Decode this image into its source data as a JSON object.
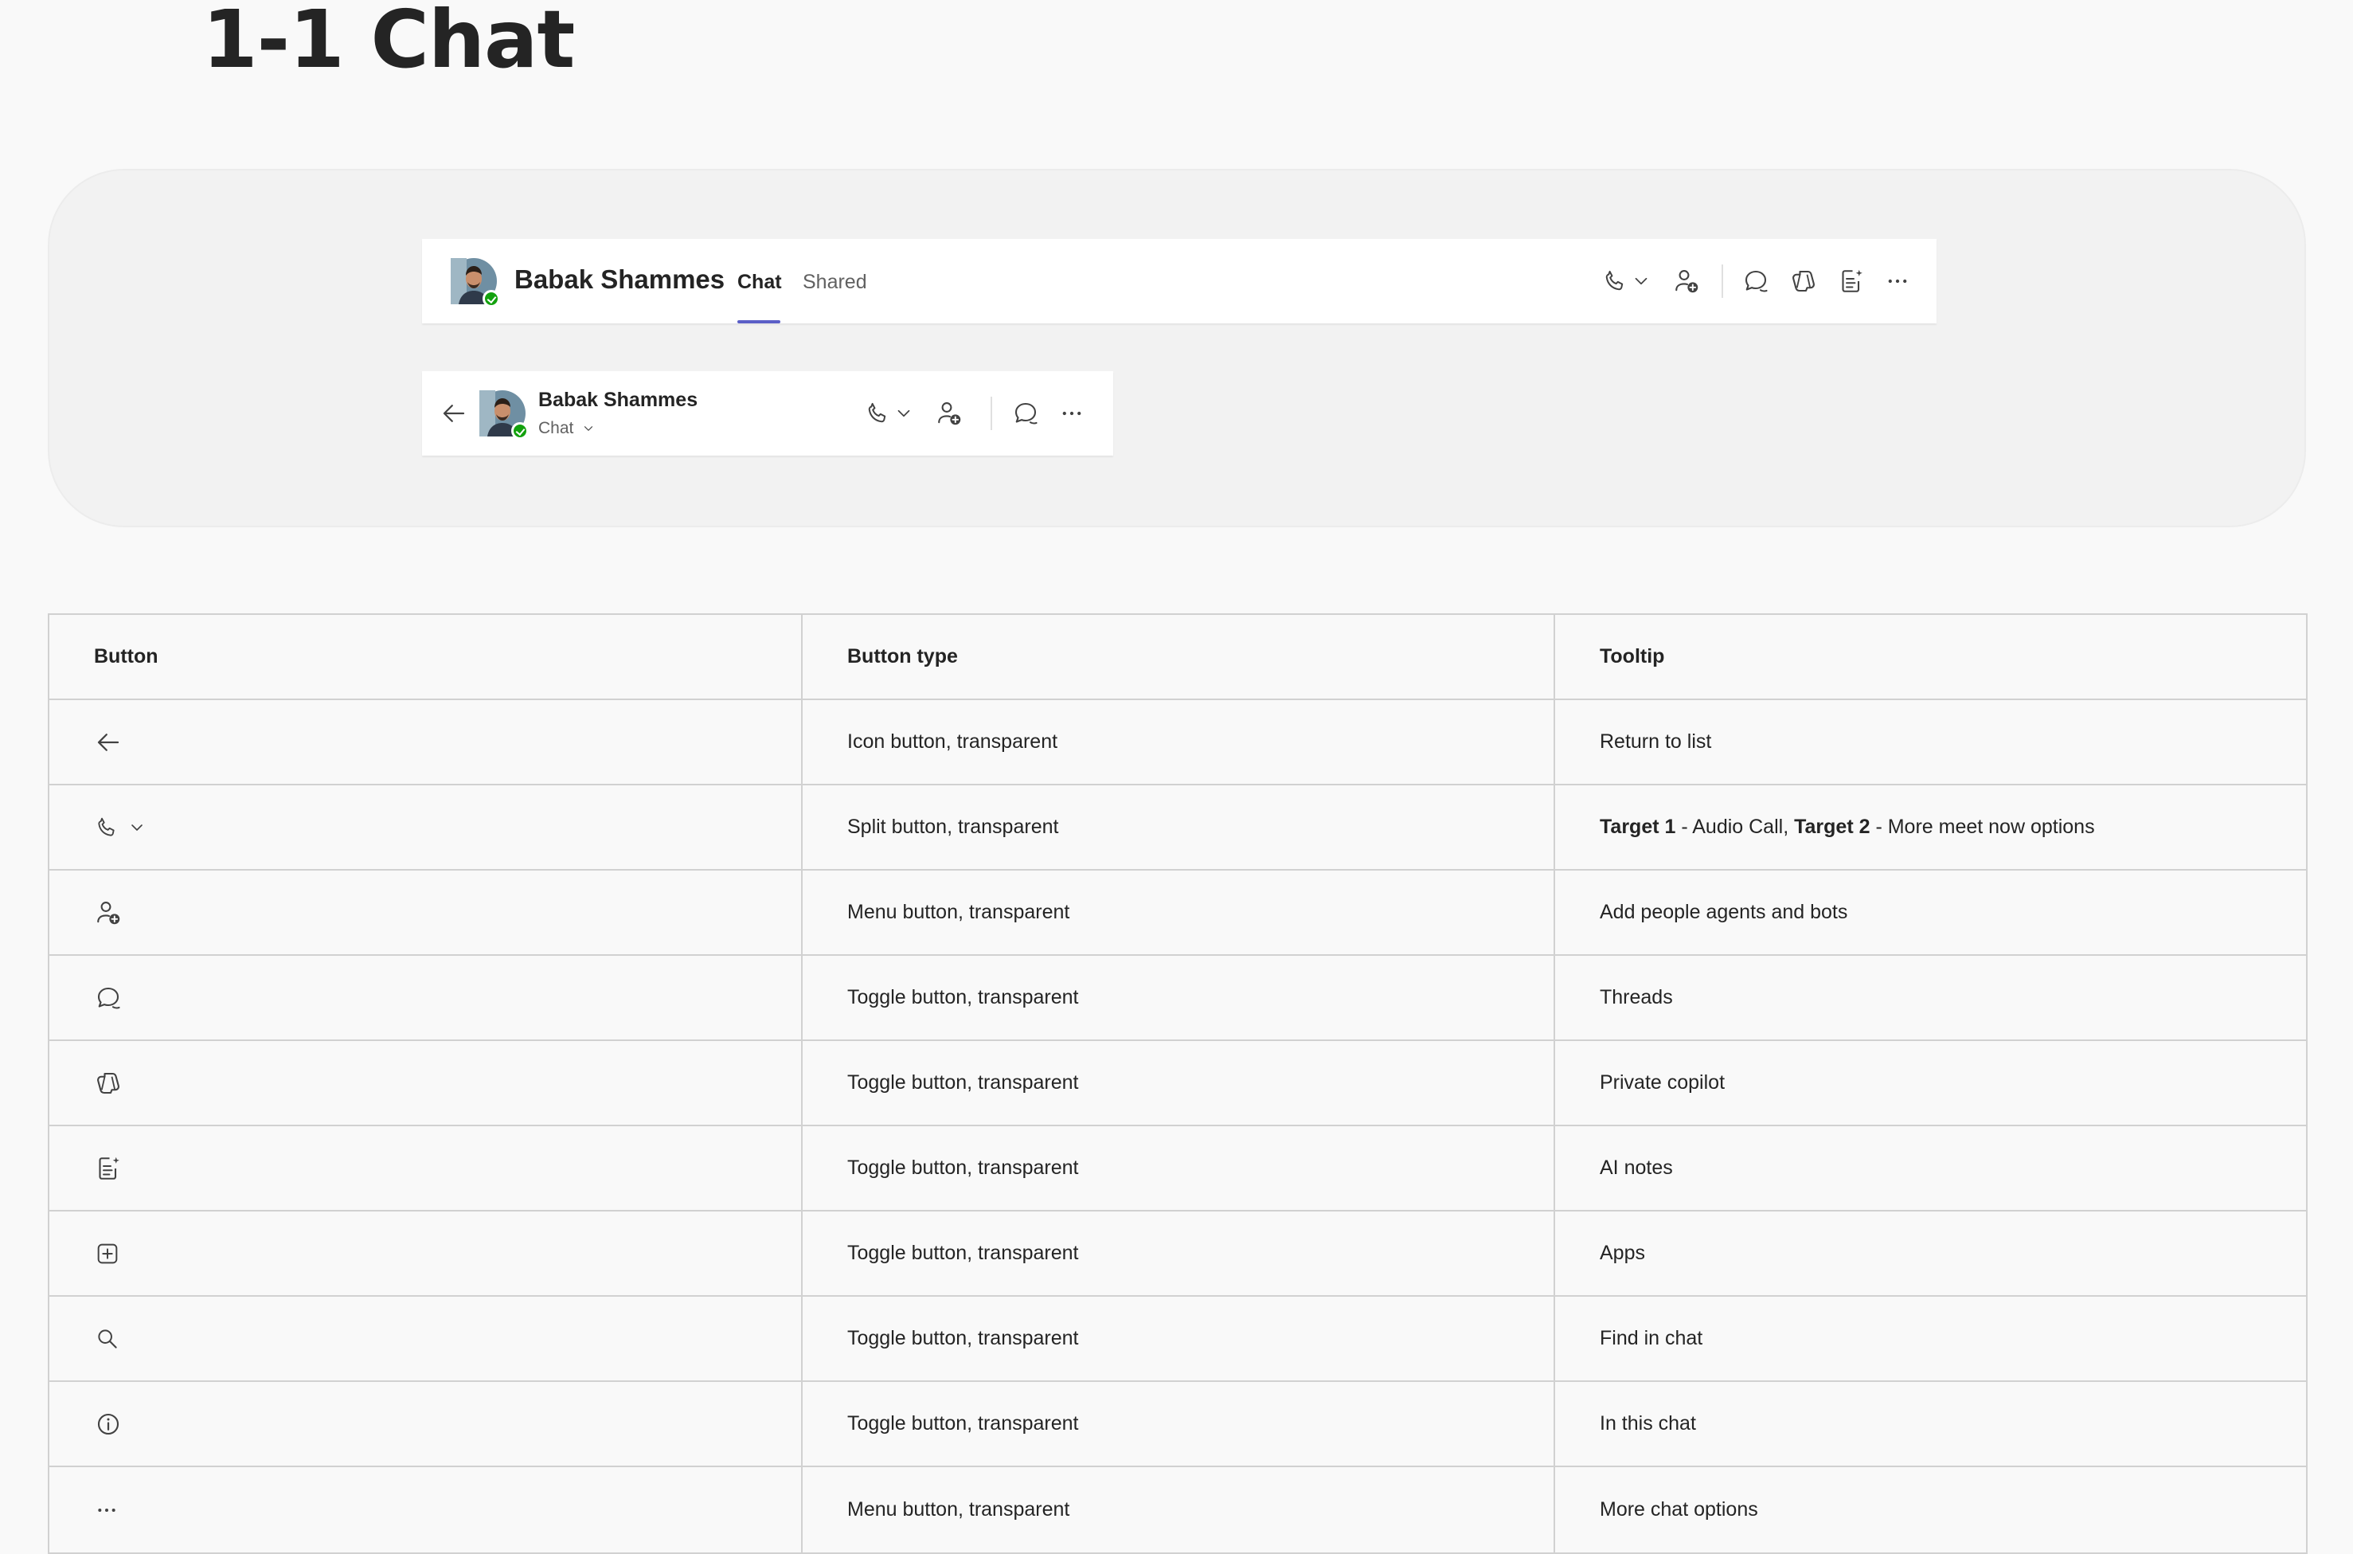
{
  "page": {
    "title": "1-1 Chat"
  },
  "header_wide": {
    "name": "Babak Shammes",
    "tabs": [
      {
        "label": "Chat",
        "active": true
      },
      {
        "label": "Shared",
        "active": false
      }
    ],
    "icons": [
      "phone-icon",
      "chevron-down-icon",
      "add-people-icon",
      "threads-icon",
      "copilot-icon",
      "ai-notes-icon",
      "more-icon"
    ]
  },
  "header_narrow": {
    "name": "Babak Shammes",
    "subtitle": "Chat",
    "icons": [
      "back-arrow-icon",
      "phone-icon",
      "chevron-down-icon",
      "add-people-icon",
      "threads-icon",
      "more-icon"
    ]
  },
  "colors": {
    "accent": "#5b5fc7",
    "presence": "#13a10e",
    "text": "#242424",
    "border": "#d1d1d1"
  },
  "table": {
    "headers": [
      "Button",
      "Button type",
      "Tooltip"
    ],
    "rows": [
      {
        "icon": "back-arrow-icon",
        "type": "Icon button, transparent",
        "tooltip": "Return to list"
      },
      {
        "icon": "phone-split-icon",
        "type": "Split button, transparent",
        "tooltip_parts": {
          "t1_label": "Target 1",
          "t1_text": " - Audio Call, ",
          "t2_label": "Target 2",
          "t2_text": " - More meet now options"
        }
      },
      {
        "icon": "add-people-icon",
        "type": "Menu button, transparent",
        "tooltip": "Add people agents and bots"
      },
      {
        "icon": "threads-icon",
        "type": "Toggle button, transparent",
        "tooltip": "Threads"
      },
      {
        "icon": "copilot-icon",
        "type": "Toggle button, transparent",
        "tooltip": "Private copilot"
      },
      {
        "icon": "ai-notes-icon",
        "type": "Toggle button, transparent",
        "tooltip": "AI notes"
      },
      {
        "icon": "apps-icon",
        "type": "Toggle button, transparent",
        "tooltip": "Apps"
      },
      {
        "icon": "search-icon",
        "type": "Toggle button, transparent",
        "tooltip": "Find in chat"
      },
      {
        "icon": "info-icon",
        "type": "Toggle button, transparent",
        "tooltip": "In this chat"
      },
      {
        "icon": "more-icon",
        "type": "Menu button, transparent",
        "tooltip": "More chat options"
      }
    ]
  }
}
